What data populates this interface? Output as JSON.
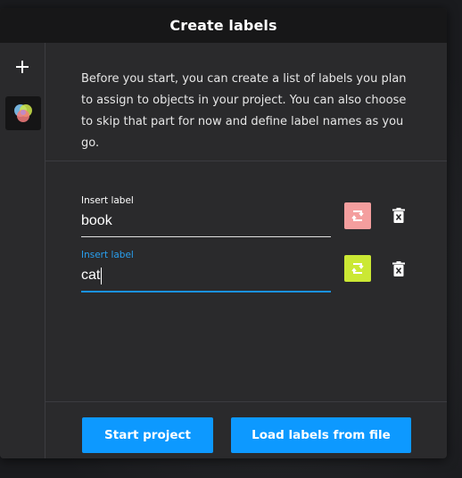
{
  "popup": {
    "title": "Create labels"
  },
  "sidebar": {
    "items": [
      {
        "icon": "plus-icon"
      },
      {
        "icon": "labels-venn-icon"
      }
    ]
  },
  "description": "Before you start, you can create a list of labels you plan to assign to objects in your project. You can also choose to skip that part for now and define label names as you go.",
  "labels": [
    {
      "field_label": "Insert label",
      "value": "book",
      "color": "#f49e9e",
      "focused": false
    },
    {
      "field_label": "Insert label",
      "value": "cat",
      "color": "#cbe834",
      "focused": true
    }
  ],
  "buttons": {
    "start": "Start project",
    "load": "Load labels from file"
  },
  "colors": {
    "accent": "#0d99ff",
    "focus_underline": "#1a92e6",
    "header_bg": "#171718",
    "popup_bg": "#2a2a2c"
  }
}
